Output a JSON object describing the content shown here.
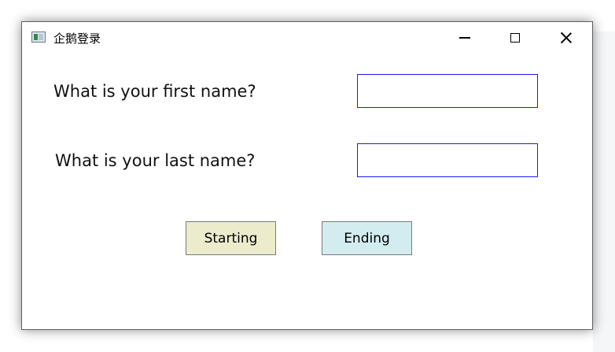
{
  "window": {
    "title": "企鹅登录",
    "app_icon": "app-window-icon",
    "controls": {
      "minimize_icon": "minimize-icon",
      "maximize_icon": "maximize-icon",
      "close_icon": "close-icon"
    }
  },
  "form": {
    "first_name_label": "What is your first name?",
    "first_name_value": "",
    "last_name_label": "What is your last name?",
    "last_name_value": ""
  },
  "buttons": {
    "starting_label": "Starting",
    "ending_label": "Ending"
  },
  "colors": {
    "input_border": "#1a1aff",
    "starting_button_bg": "#ececcd",
    "ending_button_bg": "#d3ecf0"
  }
}
